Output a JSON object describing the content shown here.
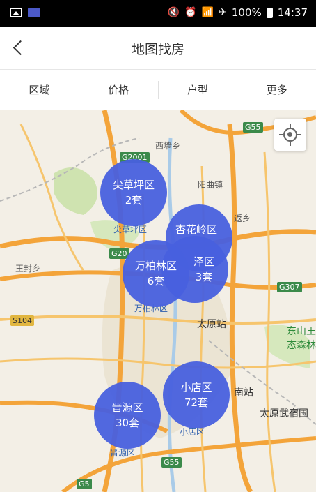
{
  "status_bar": {
    "battery": "100%",
    "time": "14:37",
    "icons": [
      "gallery-icon",
      "app-icon",
      "mute-icon",
      "alarm-icon",
      "wifi-icon",
      "airplane-icon",
      "battery-icon"
    ]
  },
  "header": {
    "title": "地图找房",
    "back_icon": "chevron-left-icon"
  },
  "filters": [
    "区域",
    "价格",
    "户型",
    "更多"
  ],
  "map": {
    "locate_icon": "crosshair-icon",
    "road_labels": [
      "G2001",
      "G55",
      "G20",
      "G307",
      "S104",
      "G55",
      "G5"
    ],
    "place_labels": [
      "西墙乡",
      "阳曲镇",
      "返乡",
      "王封乡",
      "尖草坪区",
      "万柏林区",
      "太原站",
      "东山王",
      "态森林",
      "南站",
      "太原武宿国",
      "小店区",
      "晋源区",
      "杏花岭区"
    ],
    "clusters": [
      {
        "name": "尖草坪区",
        "count": "2套"
      },
      {
        "name": "杏花岭区",
        "count": ""
      },
      {
        "name": "万柏林区",
        "count": "6套"
      },
      {
        "name": "泽区",
        "count": "3套"
      },
      {
        "name": "小店区",
        "count": "72套"
      },
      {
        "name": "晋源区",
        "count": "30套"
      }
    ]
  },
  "colors": {
    "cluster": "#4860de",
    "highway": "#f3a43a",
    "map_bg": "#f3efe6"
  }
}
